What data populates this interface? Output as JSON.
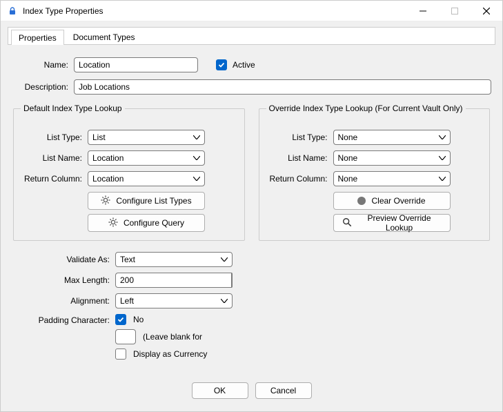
{
  "window": {
    "title": "Index Type Properties"
  },
  "tabs": [
    {
      "label": "Properties",
      "active": true
    },
    {
      "label": "Document Types",
      "active": false
    }
  ],
  "fields": {
    "name_label": "Name:",
    "name_value": "Location",
    "active_label": "Active",
    "desc_label": "Description:",
    "desc_value": "Job Locations"
  },
  "default_lookup": {
    "legend": "Default Index Type Lookup",
    "list_type_label": "List Type:",
    "list_type_value": "List",
    "list_name_label": "List Name:",
    "list_name_value": "Location",
    "return_col_label": "Return Column:",
    "return_col_value": "Location",
    "configure_list_types": "Configure List Types",
    "configure_query": "Configure Query"
  },
  "override_lookup": {
    "legend": "Override Index Type Lookup (For Current Vault Only)",
    "list_type_label": "List Type:",
    "list_type_value": "None",
    "list_name_label": "List Name:",
    "list_name_value": "None",
    "return_col_label": "Return Column:",
    "return_col_value": "None",
    "clear_override": "Clear Override",
    "preview_override": "Preview Override Lookup"
  },
  "lower": {
    "validate_as_label": "Validate As:",
    "validate_as_value": "Text",
    "max_length_label": "Max Length:",
    "max_length_value": "200",
    "alignment_label": "Alignment:",
    "alignment_value": "Left",
    "padding_char_label": "Padding Character:",
    "padding_no": "No",
    "padding_hint": "(Leave blank for",
    "display_currency": "Display as Currency"
  },
  "dialog": {
    "ok": "OK",
    "cancel": "Cancel"
  }
}
